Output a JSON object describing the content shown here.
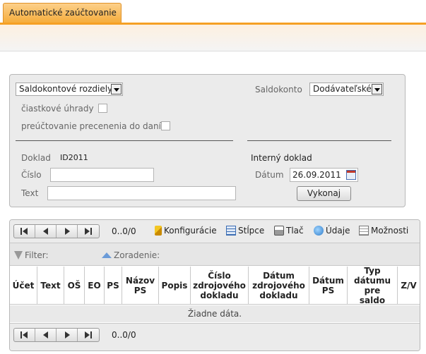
{
  "tab": {
    "title": "Automatické zaúčtovanie"
  },
  "form": {
    "type_select": "Saldokontové rozdiely",
    "saldokonto_label": "Saldokonto",
    "saldokonto_select": "Dodávateľské",
    "partial_label": "čiastkové úhrady",
    "revaluation_label": "preúčtovanie precenenia do daní",
    "doklad_label": "Doklad",
    "doklad_value": "ID2011",
    "interny_label": "Interný doklad",
    "cislo_label": "Číslo",
    "cislo_value": "",
    "text_label": "Text",
    "text_value": "",
    "datum_label": "Dátum",
    "datum_value": "26.09.2011",
    "execute_label": "Vykonaj"
  },
  "grid": {
    "page_info": "0..0/0",
    "toolbar": {
      "config": "Konfigurácie",
      "columns": "Stĺpce",
      "print": "Tlač",
      "data": "Údaje",
      "options": "Možnosti"
    },
    "filter_label": "Filter:",
    "sort_label": "Zoradenie:",
    "columns": [
      "Účet",
      "Text",
      "OŠ",
      "EO",
      "PS",
      "Názov PS",
      "Popis",
      "Číslo zdrojového dokladu",
      "Dátum zdrojového dokladu",
      "Dátum PS",
      "Typ dátumu pre saldo",
      "Z/V"
    ],
    "empty_text": "Žiadne dáta.",
    "footer_page_info": "0..0/0"
  }
}
